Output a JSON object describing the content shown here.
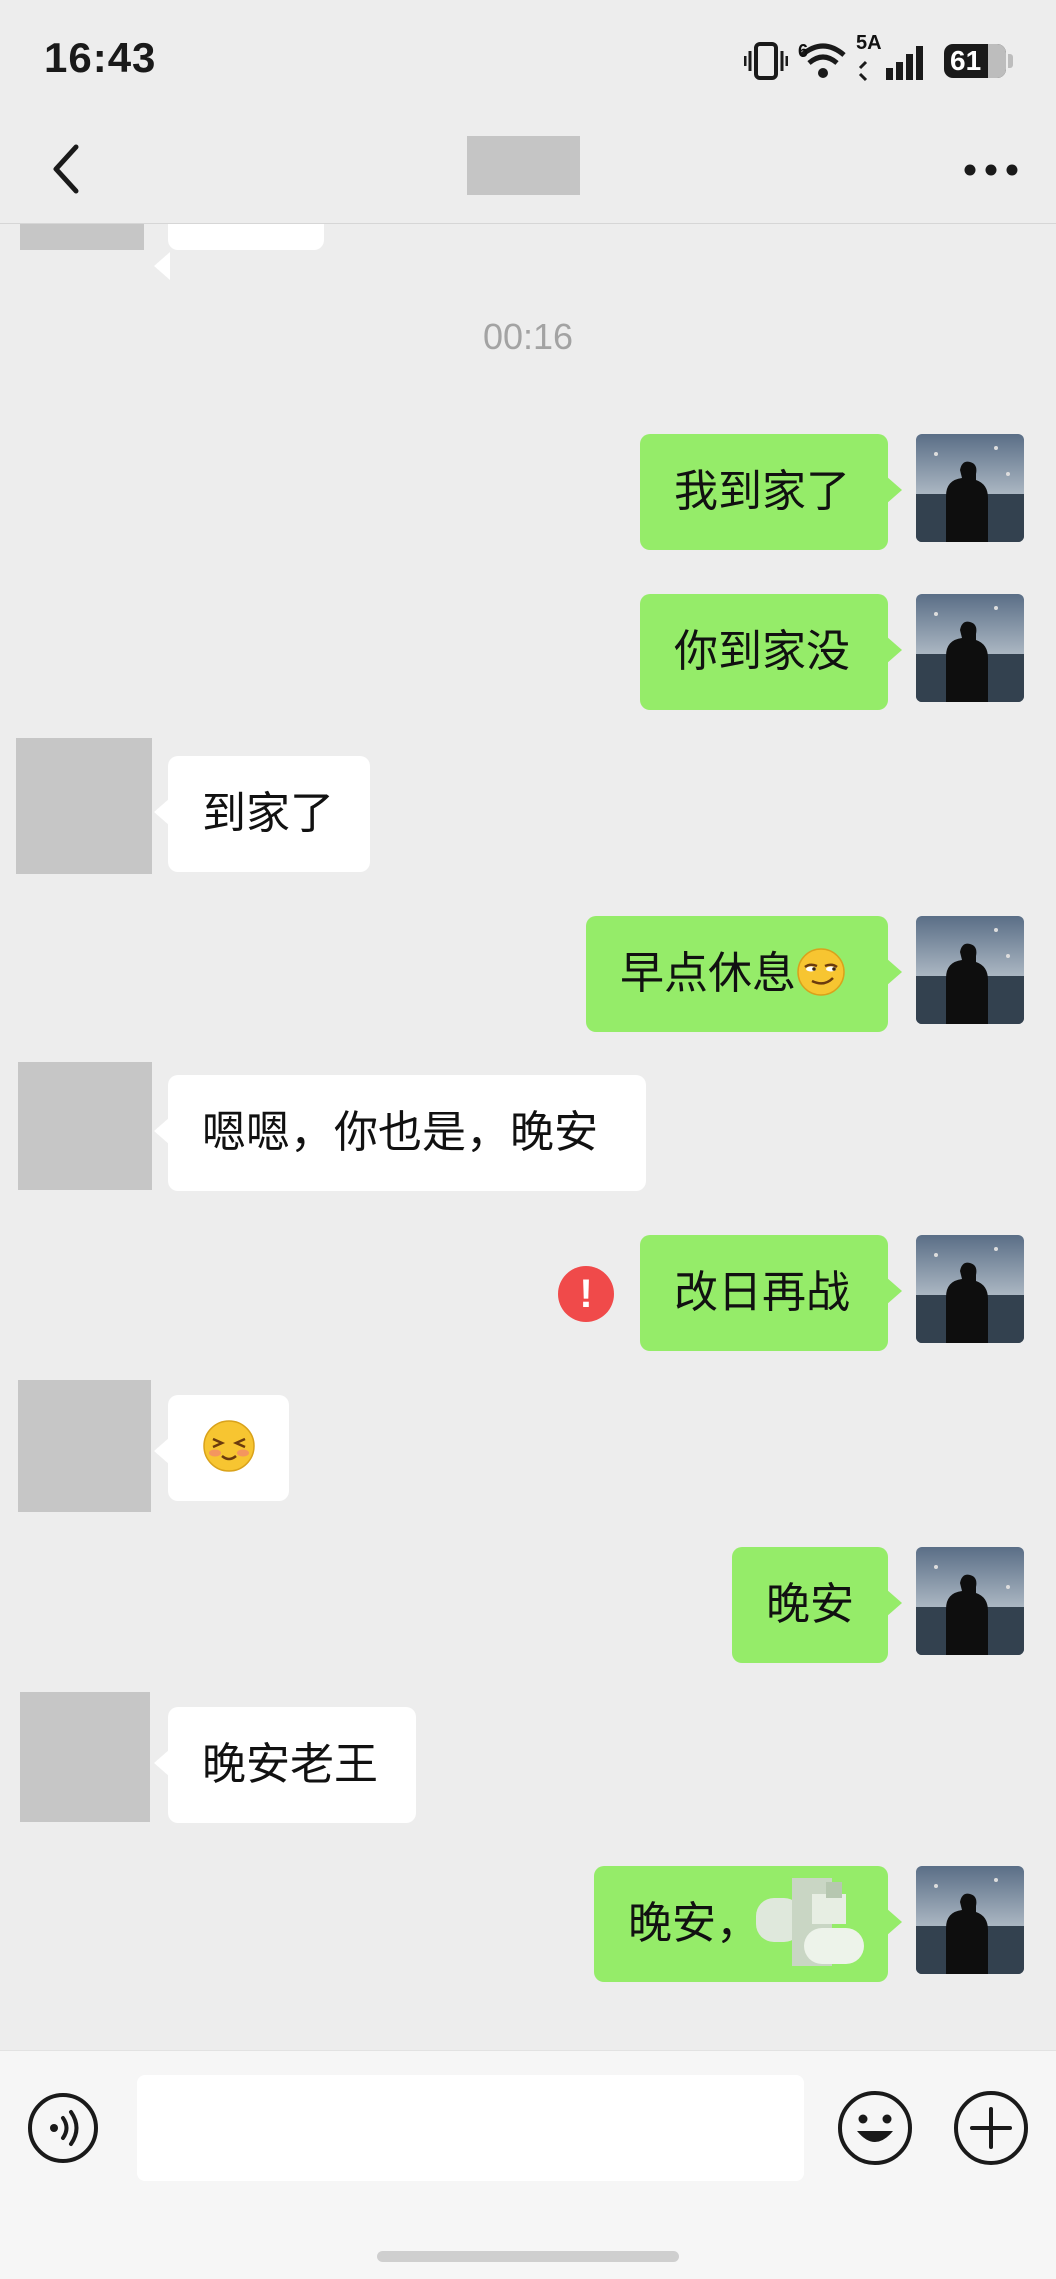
{
  "status_bar": {
    "time": "16:43",
    "network_label": "5A",
    "wifi_badge": "6",
    "battery_level": "61"
  },
  "header": {
    "more_label": "···"
  },
  "chat": {
    "timestamp": "00:16",
    "messages": [
      {
        "side": "me",
        "text": "我到家了"
      },
      {
        "side": "me",
        "text": "你到家没"
      },
      {
        "side": "them",
        "text": "到家了"
      },
      {
        "side": "me",
        "text": "早点休息",
        "emoji": "smirk-emoji"
      },
      {
        "side": "them",
        "text": "嗯嗯，你也是，晚安"
      },
      {
        "side": "me",
        "text": "改日再战",
        "status": "failed"
      },
      {
        "side": "them",
        "text": "",
        "emoji": "blush-emoji"
      },
      {
        "side": "me",
        "text": "晚安"
      },
      {
        "side": "them",
        "text": "晚安老王"
      },
      {
        "side": "me",
        "text": "晚安，",
        "emoji": "blurred-sticker"
      }
    ]
  },
  "input": {
    "value": "",
    "placeholder": ""
  },
  "colors": {
    "background": "#ededed",
    "my_bubble": "#95ec69",
    "their_bubble": "#ffffff",
    "error": "#f04a4a"
  }
}
